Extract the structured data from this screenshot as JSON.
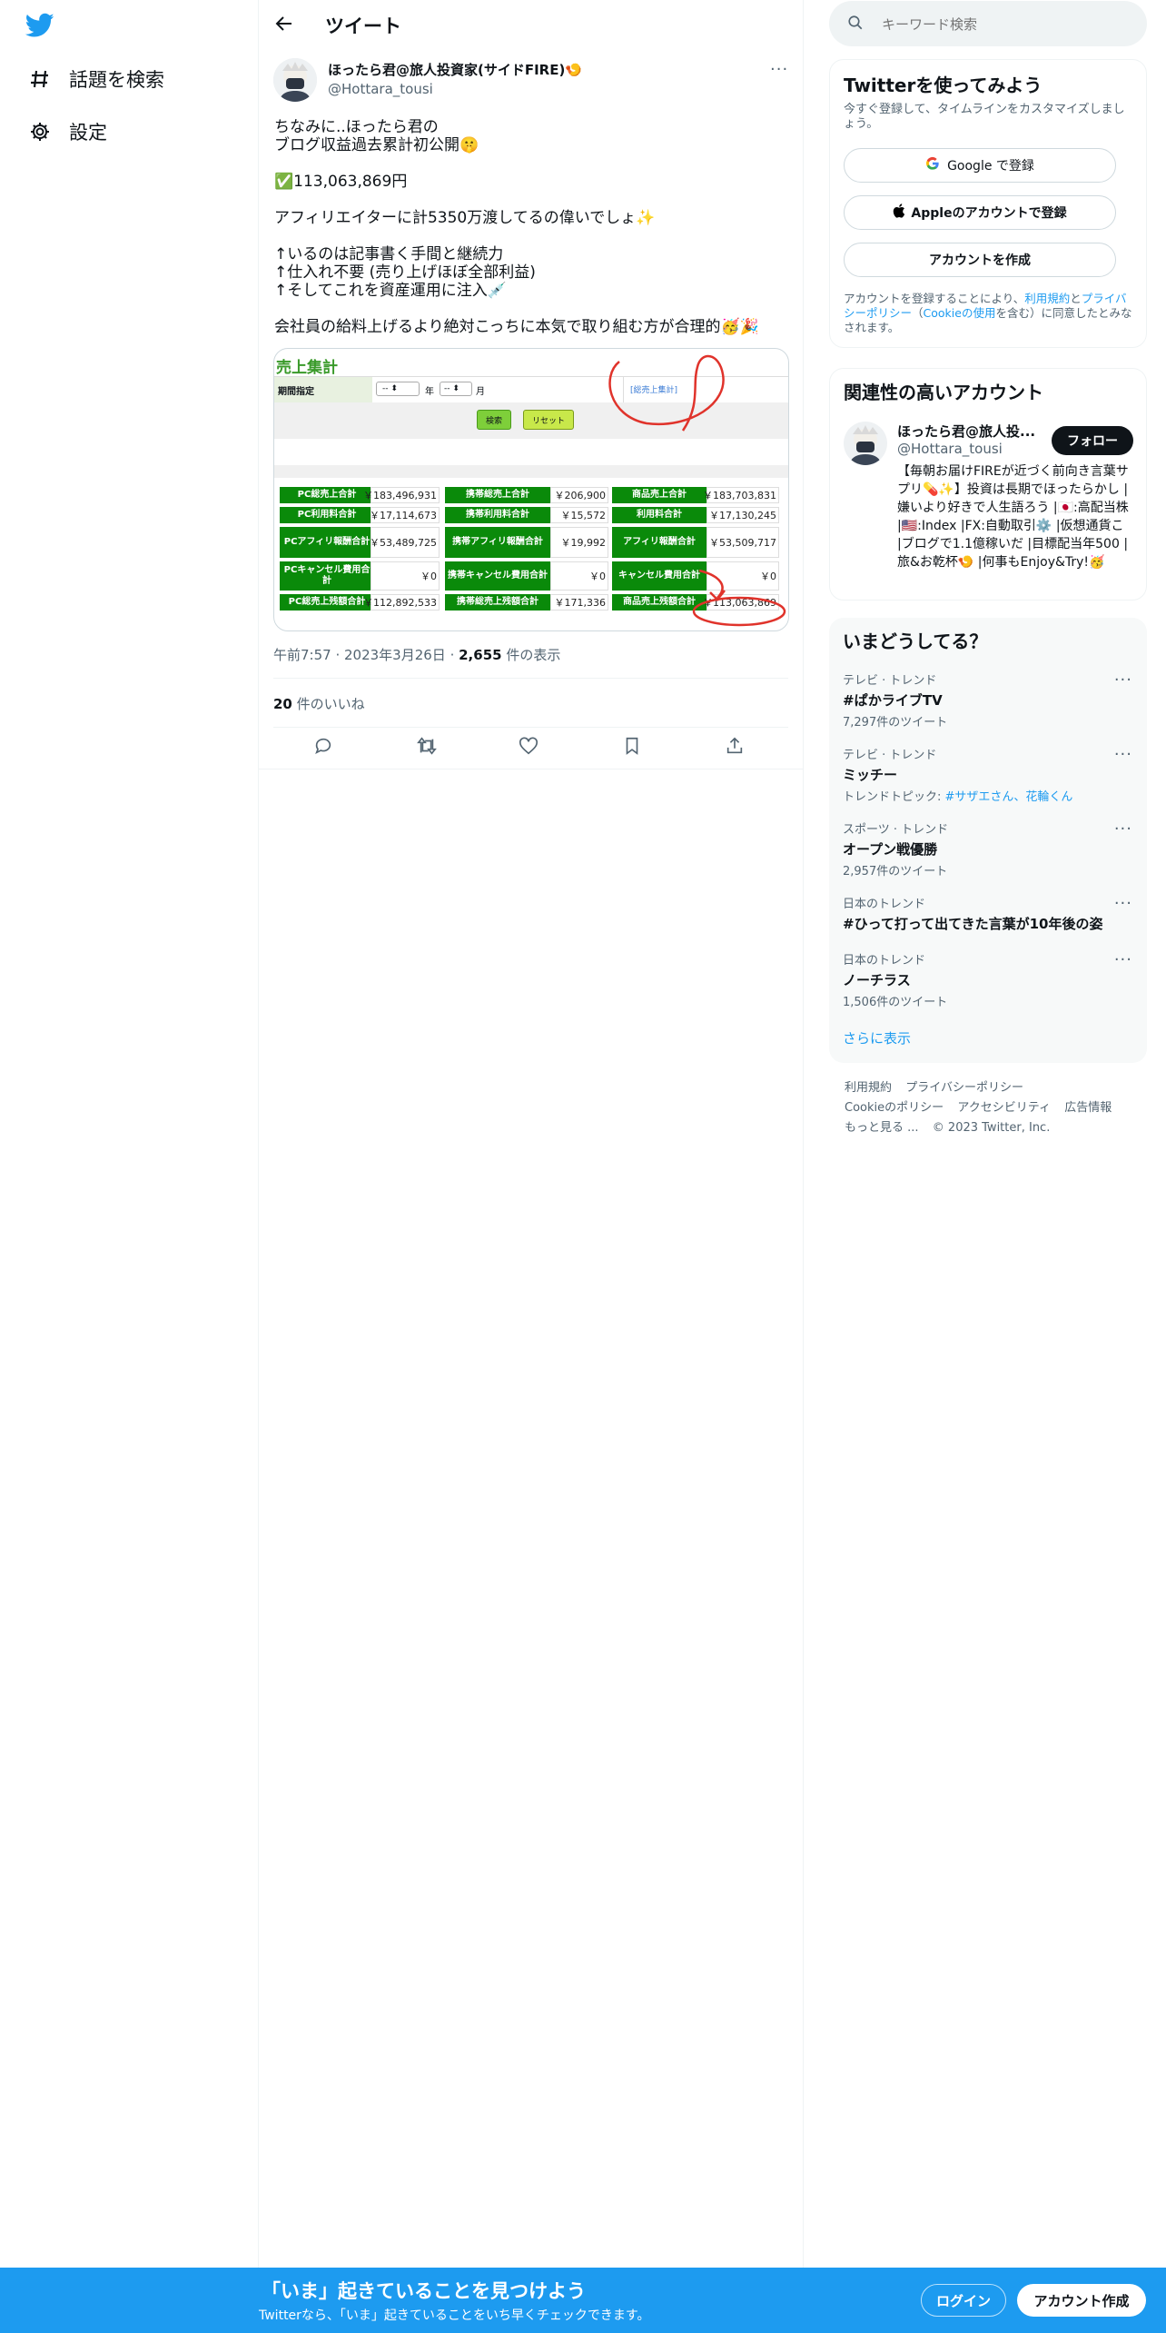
{
  "nav": {
    "explore_label": "話題を検索",
    "settings_label": "設定"
  },
  "header": {
    "title": "ツイート"
  },
  "tweet": {
    "author_name": "ほったら君@旅人投資家(サイドFIRE)🍤",
    "author_handle": "@Hottara_tousi",
    "lines": [
      "ちなみに..ほったら君の",
      "ブログ収益過去累計初公開🤫",
      "",
      "✅113,063,869円",
      "",
      "アフィリエイターに計5350万渡してるの偉いでしょ✨",
      "",
      "↑いるのは記事書く手間と継続力",
      "↑仕入れ不要 (売り上げほぼ全部利益)",
      "↑そしてこれを資産運用に注入💉",
      "",
      "会社員の給料上げるより絶対こっちに本気で取り組む方が合理的🥳🎉"
    ],
    "time": "午前7:57",
    "date": "2023年3月26日",
    "views_count": "2,655",
    "views_label": "件の表示",
    "likes_count": "20",
    "likes_label": "件のいいね"
  },
  "sheet": {
    "title": "売上集計",
    "period_label": "期間指定",
    "year_label": "年",
    "month_label": "月",
    "select_placeholder": "--",
    "link_label": "[総売上集計]",
    "search_button": "検索",
    "reset_button": "リセット",
    "rows": [
      [
        [
          "PC総売上合計",
          "￥183,496,931"
        ],
        [
          "携帯総売上合計",
          "￥206,900"
        ],
        [
          "商品売上合計",
          "￥183,703,831"
        ]
      ],
      [
        [
          "PC利用料合計",
          "￥17,114,673"
        ],
        [
          "携帯利用料合計",
          "￥15,572"
        ],
        [
          "利用料合計",
          "￥17,130,245"
        ]
      ],
      [
        [
          "PCアフィリ報酬合計",
          "￥53,489,725"
        ],
        [
          "携帯アフィリ報酬合計",
          "￥19,992"
        ],
        [
          "アフィリ報酬合計",
          "￥53,509,717"
        ]
      ],
      [
        [
          "PCキャンセル費用合計",
          "￥0"
        ],
        [
          "携帯キャンセル費用合計",
          "￥0"
        ],
        [
          "キャンセル費用合計",
          "￥0"
        ]
      ],
      [
        [
          "PC総売上残額合計",
          "￥112,892,533"
        ],
        [
          "携帯総売上残額合計",
          "￥171,336"
        ],
        [
          "商品売上残額合計",
          "￥113,063,869"
        ]
      ]
    ]
  },
  "search": {
    "placeholder": "キーワード検索"
  },
  "signup": {
    "title": "Twitterを使ってみよう",
    "subtitle": "今すぐ登録して、タイムラインをカスタマイズしましょう。",
    "google_label": "Google で登録",
    "apple_label": "Appleのアカウントで登録",
    "create_label": "アカウントを作成",
    "legal_prefix": "アカウントを登録することにより、",
    "legal_terms": "利用規約",
    "legal_and": "と",
    "legal_privacy": "プライバシーポリシー",
    "legal_paren_open": "（",
    "legal_cookie": "Cookieの使用",
    "legal_suffix": "を含む）に同意したとみなされます。"
  },
  "related": {
    "title": "関連性の高いアカウント",
    "name": "ほったら君@旅人投...",
    "handle": "@Hottara_tousi",
    "follow_label": "フォロー",
    "bio": "【毎朝お届けFIREが近づく前向き言葉サプリ💊✨】投資は長期でほったらかし |嫌いより好きで人生語ろう |🇯🇵:高配当株 |🇺🇸:Index |FX:自動取引⚙️ |仮想通貨こ |ブログで1.1億稼いだ |目標配当年500 |旅&お乾杯🍤 |何事もEnjoy&Try!🥳"
  },
  "trends": {
    "title": "いまどうしてる？",
    "items": [
      {
        "context": "テレビ · トレンド",
        "name": "#ぱかライブTV",
        "meta": "7,297件のツイート"
      },
      {
        "context": "テレビ · トレンド",
        "name": "ミッチー",
        "meta_prefix": "トレンドトピック: ",
        "meta_link": "#サザエさん、花輪くん"
      },
      {
        "context": "スポーツ · トレンド",
        "name": "オープン戦優勝",
        "meta": "2,957件のツイート"
      },
      {
        "context": "日本のトレンド",
        "name": "#ひって打って出てきた言葉が10年後の姿",
        "meta": ""
      },
      {
        "context": "日本のトレンド",
        "name": "ノーチラス",
        "meta": "1,506件のツイート"
      }
    ],
    "show_more": "さらに表示"
  },
  "footer": {
    "terms": "利用規約",
    "privacy": "プライバシーポリシー",
    "cookie": "Cookieのポリシー",
    "accessibility": "アクセシビリティ",
    "ads": "広告情報",
    "more": "もっと見る ...",
    "copyright": "© 2023 Twitter, Inc."
  },
  "bottom": {
    "headline": "「いま」起きていることを見つけよう",
    "sub": "Twitterなら、「いま」起きていることをいち早くチェックできます。",
    "login_label": "ログイン",
    "signup_label": "アカウント作成"
  },
  "colors": {
    "brand": "#1d9bf0",
    "sheet_green": "#0a8a0a",
    "annotation_red": "#e0332b"
  }
}
